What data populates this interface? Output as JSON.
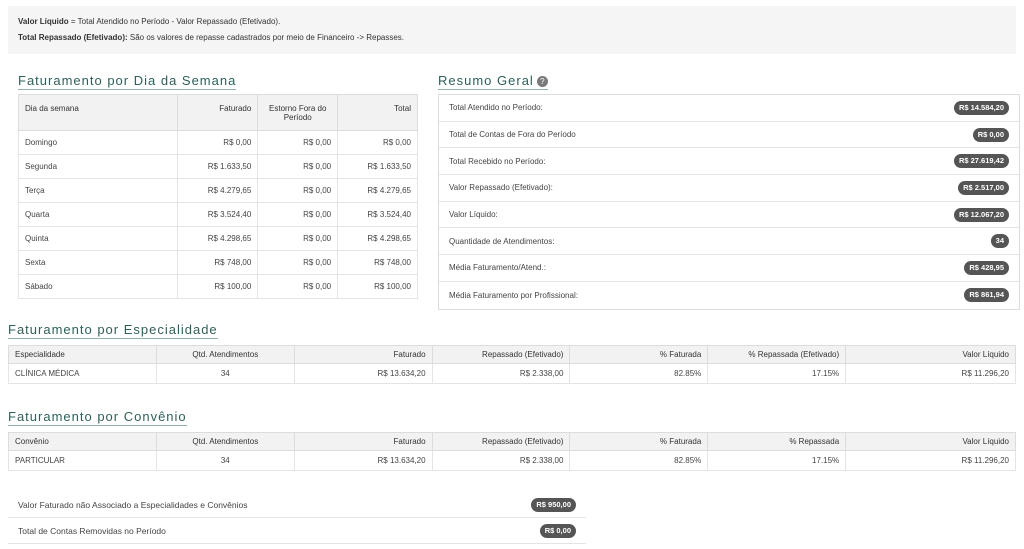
{
  "info": {
    "line1_bold": "Valor Líquido",
    "line1_rest": " = Total Atendido no Período - Valor Repassado (Efetivado).",
    "line2_bold": "Total Repassado (Efetivado):",
    "line2_rest": " São os valores de repasse cadastrados por meio de Financeiro -> Repasses."
  },
  "week": {
    "title": "Faturamento por Dia da Semana",
    "headers": [
      "Dia da semana",
      "Faturado",
      "Estorno Fora do Período",
      "Total"
    ],
    "rows": [
      [
        "Domingo",
        "R$ 0,00",
        "R$ 0,00",
        "R$ 0,00"
      ],
      [
        "Segunda",
        "R$ 1.633,50",
        "R$ 0,00",
        "R$ 1.633,50"
      ],
      [
        "Terça",
        "R$ 4.279,65",
        "R$ 0,00",
        "R$ 4.279,65"
      ],
      [
        "Quarta",
        "R$ 3.524,40",
        "R$ 0,00",
        "R$ 3.524,40"
      ],
      [
        "Quinta",
        "R$ 4.298,65",
        "R$ 0,00",
        "R$ 4.298,65"
      ],
      [
        "Sexta",
        "R$ 748,00",
        "R$ 0,00",
        "R$ 748,00"
      ],
      [
        "Sábado",
        "R$ 100,00",
        "R$ 0,00",
        "R$ 100,00"
      ]
    ]
  },
  "summary": {
    "title": "Resumo Geral",
    "help_glyph": "?",
    "rows": [
      {
        "label": "Total Atendido no Período:",
        "value": "R$ 14.584,20"
      },
      {
        "label": "Total de Contas de Fora do Período",
        "value": "R$ 0,00"
      },
      {
        "label": "Total Recebido no Período:",
        "value": "R$ 27.619,42"
      },
      {
        "label": "Valor Repassado (Efetivado):",
        "value": "R$ 2.517,00"
      },
      {
        "label": "Valor Líquido:",
        "value": "R$ 12.067,20"
      },
      {
        "label": "Quantidade de Atendimentos:",
        "value": "34"
      },
      {
        "label": "Média Faturamento/Atend.:",
        "value": "R$ 428,95"
      },
      {
        "label": "Média Faturamento por Profissional:",
        "value": "R$ 861,94"
      }
    ]
  },
  "specialty": {
    "title": "Faturamento por Especialidade",
    "headers": [
      "Especialidade",
      "Qtd. Atendimentos",
      "Faturado",
      "Repassado (Efetivado)",
      "% Faturada",
      "% Repassada (Efetivado)",
      "Valor Líquido"
    ],
    "rows": [
      [
        "CLÍNICA MÉDICA",
        "34",
        "R$ 13.634,20",
        "R$ 2.338,00",
        "82.85%",
        "17.15%",
        "R$ 11.296,20"
      ]
    ]
  },
  "insurance": {
    "title": "Faturamento por Convênio",
    "headers": [
      "Convênio",
      "Qtd. Atendimentos",
      "Faturado",
      "Repassado (Efetivado)",
      "% Faturada",
      "% Repassada",
      "Valor Líquido"
    ],
    "rows": [
      [
        "PARTICULAR",
        "34",
        "R$ 13.634,20",
        "R$ 2.338,00",
        "82.85%",
        "17.15%",
        "R$ 11.296,20"
      ]
    ]
  },
  "extra": {
    "rows": [
      {
        "label": "Valor Faturado não Associado a Especialidades e Convênios",
        "value": "R$ 950,00"
      },
      {
        "label": "Total de Contas Removidas no Período",
        "value": "R$ 0,00"
      }
    ]
  }
}
